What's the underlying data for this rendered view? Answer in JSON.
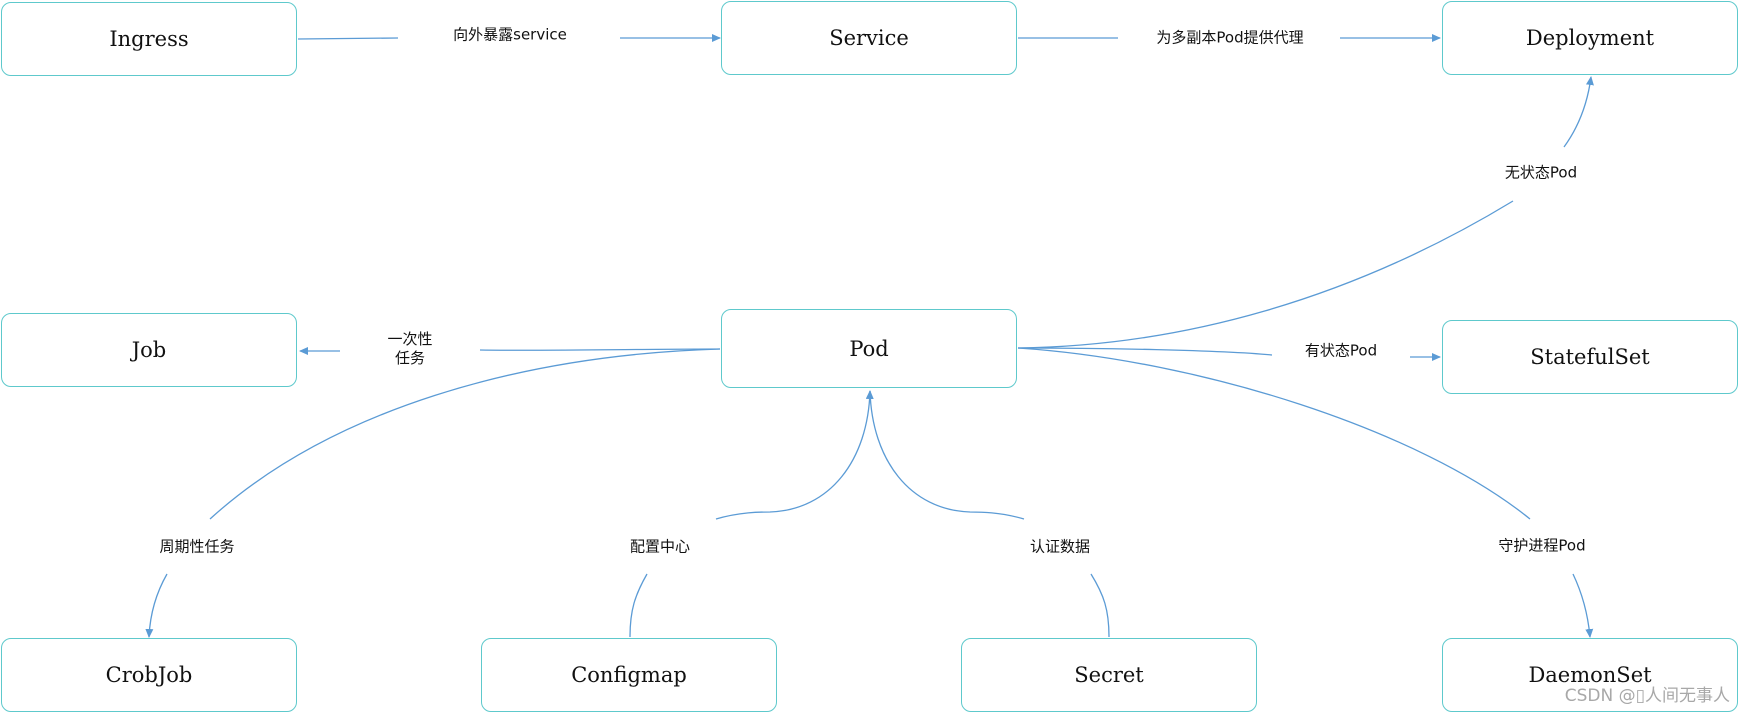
{
  "colors": {
    "node_border": "#5ec9cc",
    "edge": "#5b9bd5"
  },
  "nodes": {
    "ingress": "Ingress",
    "service": "Service",
    "deployment": "Deployment",
    "job": "Job",
    "pod": "Pod",
    "statefulset": "StatefulSet",
    "crobjob": "CrobJob",
    "configmap": "Configmap",
    "secret": "Secret",
    "daemonset": "DaemonSet"
  },
  "edges": {
    "ingress_service": "向外暴露service",
    "service_deployment": "为多副本Pod提供代理",
    "pod_deployment": "无状态Pod",
    "pod_job_line1": "一次性",
    "pod_job_line2": "任务",
    "pod_statefulset": "有状态Pod",
    "pod_crobjob": "周期性任务",
    "configmap_pod": "配置中心",
    "secret_pod": "认证数据",
    "pod_daemonset": "守护进程Pod"
  },
  "watermark": "CSDN @▯人间无事人"
}
